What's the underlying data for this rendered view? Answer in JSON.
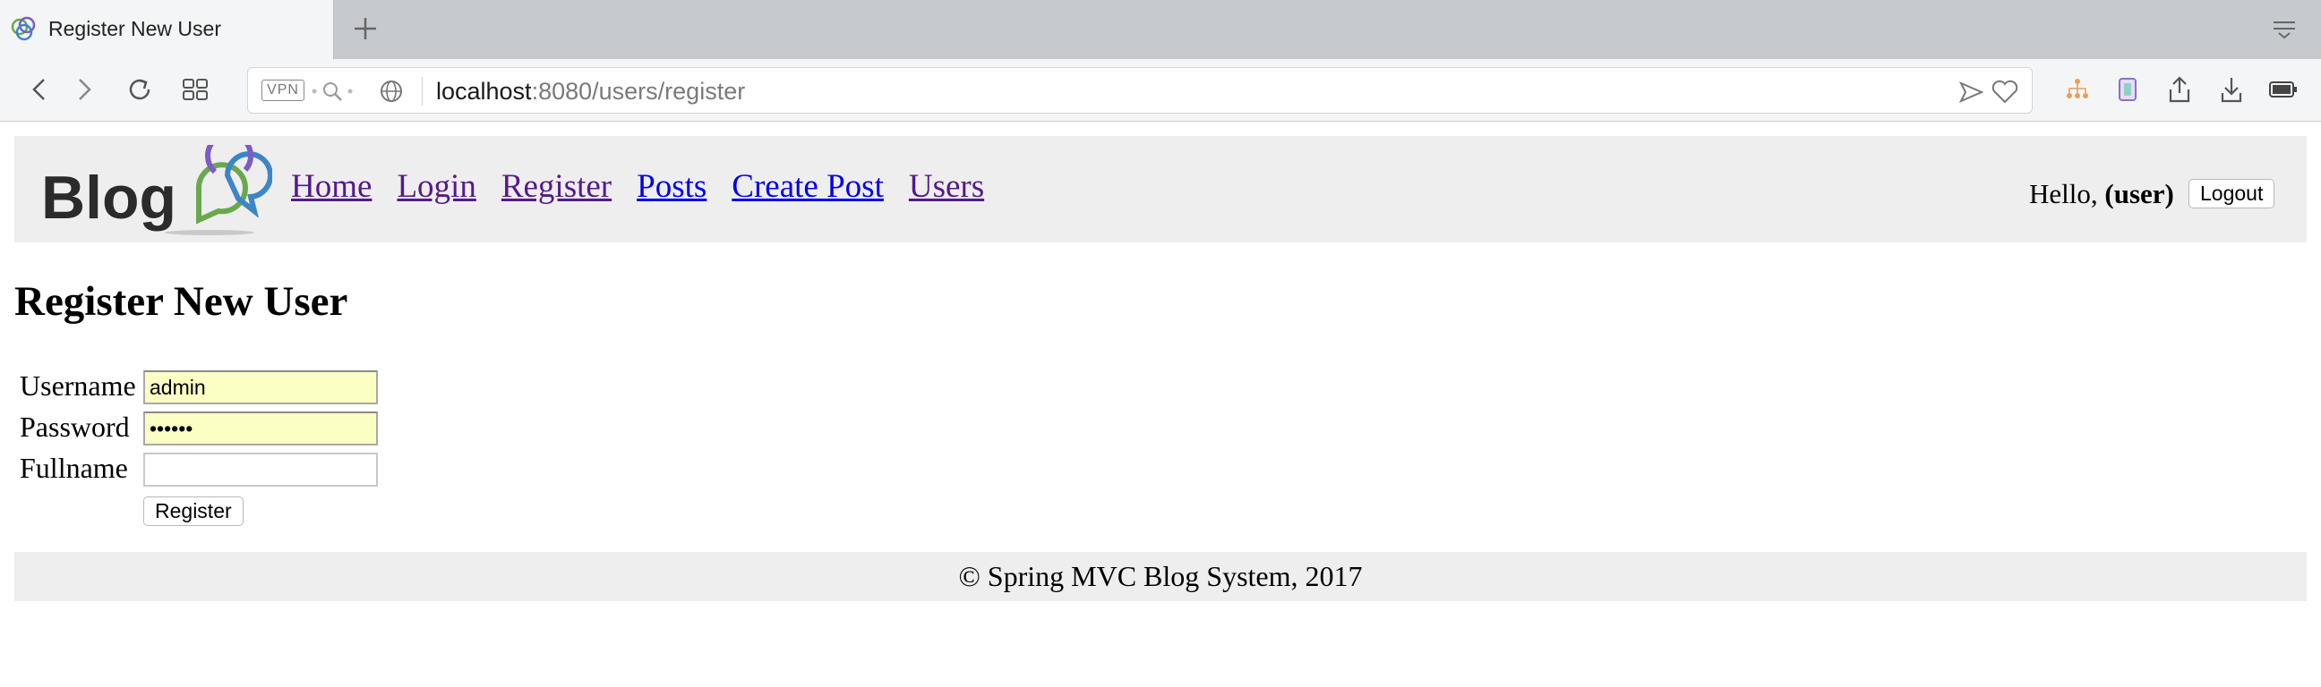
{
  "browser": {
    "tab_title": "Register New User",
    "url_host": "localhost",
    "url_path": ":8080/users/register",
    "vpn_label": "VPN"
  },
  "site": {
    "nav": [
      "Home",
      "Login",
      "Register",
      "Posts",
      "Create Post",
      "Users"
    ],
    "greeting_prefix": "Hello, ",
    "username": "(user)",
    "logout_label": "Logout",
    "logo_text": "Blog"
  },
  "page": {
    "title": "Register New User",
    "form": {
      "username_label": "Username",
      "username_value": "admin",
      "password_label": "Password",
      "password_value": "••••••",
      "fullname_label": "Fullname",
      "fullname_value": "",
      "submit_label": "Register"
    }
  },
  "footer": {
    "text": "© Spring MVC Blog System, 2017"
  },
  "colors": {
    "link": "#0000ee",
    "visited_link": "#551a8b",
    "header_bg": "#eeeeee",
    "autofill_bg": "#fbffc3"
  }
}
